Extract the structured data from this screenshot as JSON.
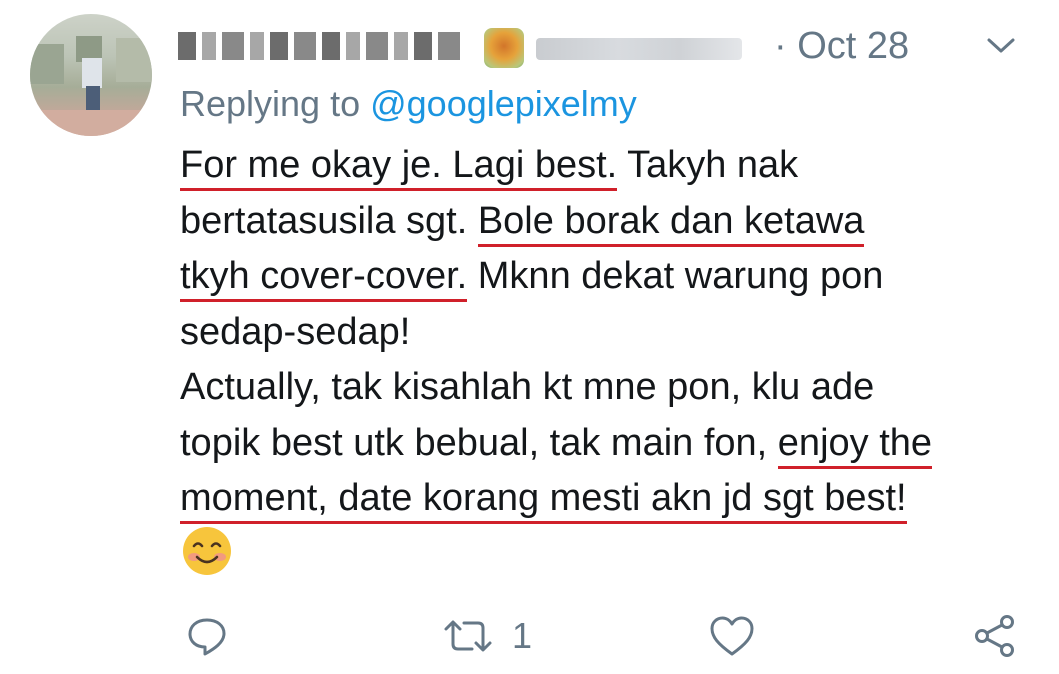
{
  "tweet": {
    "date_separator": "·",
    "date": "Oct 28",
    "replying_prefix": "Replying to ",
    "replying_handle": "@googlepixelmy",
    "lines": {
      "l1a": "For me okay je. Lagi best.",
      "l1b": " Takyh nak",
      "l2a": "bertatasusila sgt. ",
      "l2b": "Bole borak dan ketawa",
      "l3a": "tkyh cover-cover.",
      "l3b": " Mknn dekat warung pon",
      "l4": "sedap-sedap!",
      "l5": "Actually, tak kisahlah kt mne pon, klu ade",
      "l6a": "topik best utk bebual, tak main fon, ",
      "l6b": "enjoy the",
      "l7": "moment, date korang mesti akn jd sgt best!"
    },
    "emoji": "smiling-face-with-smiling-eyes",
    "retweet_count": "1"
  },
  "colors": {
    "text": "#14171a",
    "muted": "#657786",
    "mention": "#1b95e0",
    "underline": "#d0202a"
  },
  "icons": {
    "menu": "chevron-down-icon",
    "reply": "reply-icon",
    "retweet": "retweet-icon",
    "like": "heart-icon",
    "share": "share-icon"
  }
}
